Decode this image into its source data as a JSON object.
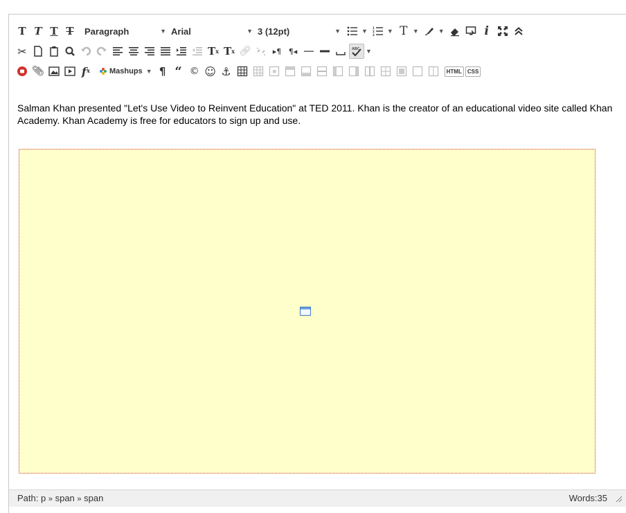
{
  "toolbar": {
    "row1": {
      "format_select": "Paragraph",
      "font_select": "Arial",
      "size_select": "3 (12pt)"
    },
    "row3": {
      "mashups_label": "Mashups",
      "html_label": "HTML",
      "css_label": "CSS"
    }
  },
  "content": {
    "paragraph": "Salman Khan presented \"Let's Use Video to Reinvent Education\" at TED 2011.  Khan is the creator of an educational video site called Khan Academy.  Khan Academy is free for educators to sign up and use."
  },
  "statusbar": {
    "path_label": "Path:",
    "path": [
      "p",
      "span",
      "span"
    ],
    "path_sep": "»",
    "words_label": "Words:",
    "word_count": "35"
  },
  "colors": {
    "placeholder_bg": "#ffffcc",
    "placeholder_border": "#c83c3c",
    "mashups_dots": [
      "#e8462b",
      "#3b8ed6",
      "#35a853",
      "#f2b300"
    ]
  }
}
